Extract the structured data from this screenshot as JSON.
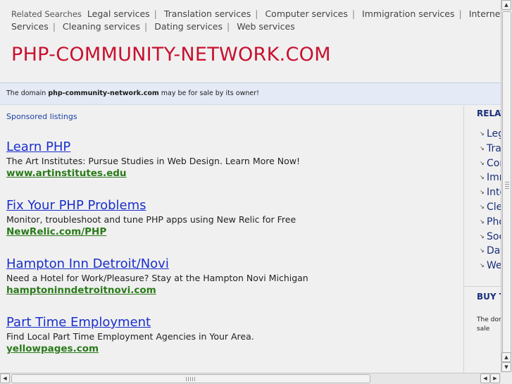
{
  "top_related": {
    "label": "Related Searches",
    "links": [
      "Legal services",
      "Translation services",
      "Computer services",
      "Immigration services",
      "Internet Services",
      "Cleaning services",
      "Dating services",
      "Web services"
    ]
  },
  "site_title": "PHP-COMMUNITY-NETWORK.COM",
  "for_sale_bar": {
    "prefix": "The domain",
    "domain": "php-community-network.com",
    "suffix": "may be for sale by its owner!"
  },
  "sponsored_label": "Sponsored listings",
  "listings": [
    {
      "title": "Learn PHP",
      "desc": "The Art Institutes: Pursue Studies in Web Design. Learn More Now!",
      "url": "www.artinstitutes.edu"
    },
    {
      "title": "Fix Your PHP Problems",
      "desc": "Monitor, troubleshoot and tune PHP apps using New Relic for Free",
      "url": "NewRelic.com/PHP"
    },
    {
      "title": "Hampton Inn Detroit/Novi",
      "desc": "Need a Hotel for Work/Pleasure? Stay at the Hampton Novi Michigan",
      "url": "hamptoninndetroitnovi.com"
    },
    {
      "title": "Part Time Employment",
      "desc": "Find Local Part Time Employment Agencies in Your Area.",
      "url": "yellowpages.com"
    }
  ],
  "sidebar": {
    "heading": "RELAT",
    "items": [
      "Leg",
      "Tra",
      "Cor",
      "Imm",
      "Inte",
      "Cle",
      "Pho",
      "Soc",
      "Dat",
      "We"
    ],
    "buy_heading": "BUY T",
    "buy_text": "The dom for sale"
  },
  "colors": {
    "title_red": "#c8102e",
    "link_blue": "#1a2fcc",
    "url_green": "#2a7a1a",
    "bar_bg": "#e4eaf6"
  }
}
